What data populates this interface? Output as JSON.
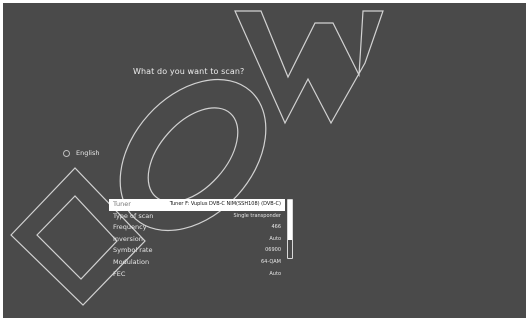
{
  "screen": {
    "title": "What do you want to scan?"
  },
  "language_option": {
    "label": "English",
    "selected": false
  },
  "scan_settings": [
    {
      "label": "Tuner",
      "value": "Tuner F: Vuplus DVB-C NIM(SSH108) (DVB-C)"
    },
    {
      "label": "Type of scan",
      "value": "Single transponder"
    },
    {
      "label": "Frequency",
      "value": "466"
    },
    {
      "label": "Inversion",
      "value": "Auto"
    },
    {
      "label": "Symbol rate",
      "value": "06900"
    },
    {
      "label": "Modulation",
      "value": "64-QAM"
    },
    {
      "label": "FEC",
      "value": "Auto"
    }
  ],
  "colors": {
    "background": "#4a4a4a",
    "highlight": "#ffffff",
    "text": "#e6e6e6"
  }
}
